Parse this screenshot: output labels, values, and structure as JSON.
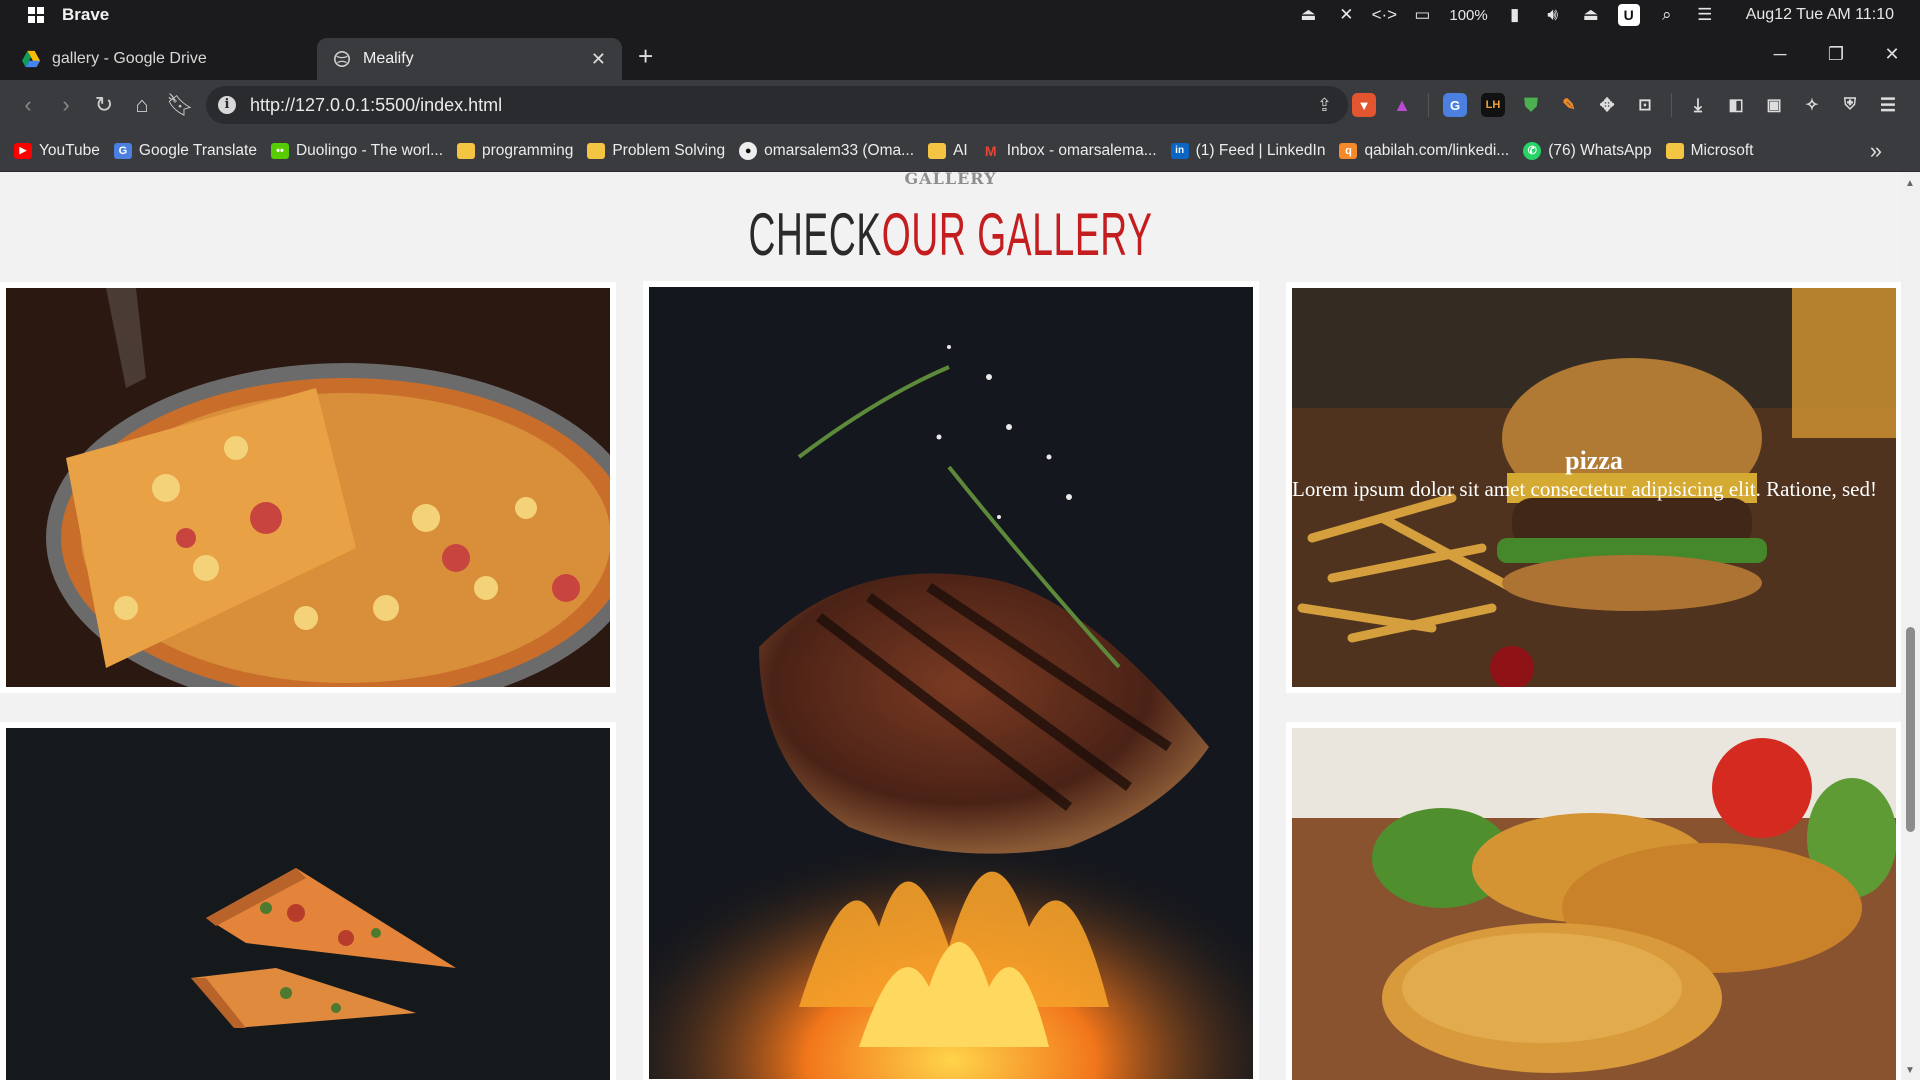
{
  "system": {
    "app_name": "Brave",
    "battery": "100%",
    "datetime": "Aug12 Tue AM 11:10"
  },
  "tabs": [
    {
      "title": "gallery - Google Drive",
      "active": false
    },
    {
      "title": "Mealify",
      "active": true
    }
  ],
  "toolbar": {
    "url": "http://127.0.0.1:5500/index.html"
  },
  "bookmarks": [
    {
      "label": "YouTube",
      "icon": "youtube-icon"
    },
    {
      "label": "Google Translate",
      "icon": "google-translate-icon"
    },
    {
      "label": "Duolingo - The worl...",
      "icon": "duolingo-icon"
    },
    {
      "label": "programming",
      "icon": "folder-icon"
    },
    {
      "label": "Problem Solving",
      "icon": "folder-icon"
    },
    {
      "label": "omarsalem33 (Oma...",
      "icon": "github-icon"
    },
    {
      "label": "AI",
      "icon": "folder-icon"
    },
    {
      "label": "Inbox - omarsalema...",
      "icon": "gmail-icon"
    },
    {
      "label": "(1) Feed | LinkedIn",
      "icon": "linkedin-icon"
    },
    {
      "label": "qabilah.com/linkedi...",
      "icon": "qabilah-icon"
    },
    {
      "label": "(76) WhatsApp",
      "icon": "whatsapp-icon"
    },
    {
      "label": "Microsoft",
      "icon": "folder-icon"
    }
  ],
  "page": {
    "section_tag": "GALLERY",
    "title_main": "CHECK",
    "title_accent": "OUR GALLERY",
    "gallery": [
      {
        "name": "pizza-slice-lift",
        "overlay": false
      },
      {
        "name": "grilled-steak-flames",
        "overlay": false
      },
      {
        "name": "burger-fries",
        "overlay": true,
        "heading": "pizza",
        "text": "Lorem ipsum dolor sit amet consectetur adipisicing elit. Ratione, sed!"
      },
      {
        "name": "flying-pizza-slices",
        "overlay": false
      },
      {
        "name": "fried-chicken",
        "overlay": false
      }
    ]
  },
  "colors": {
    "accent": "#c41d20",
    "browser_chrome": "#3a3b3e",
    "page_bg": "#f2f2f2"
  }
}
